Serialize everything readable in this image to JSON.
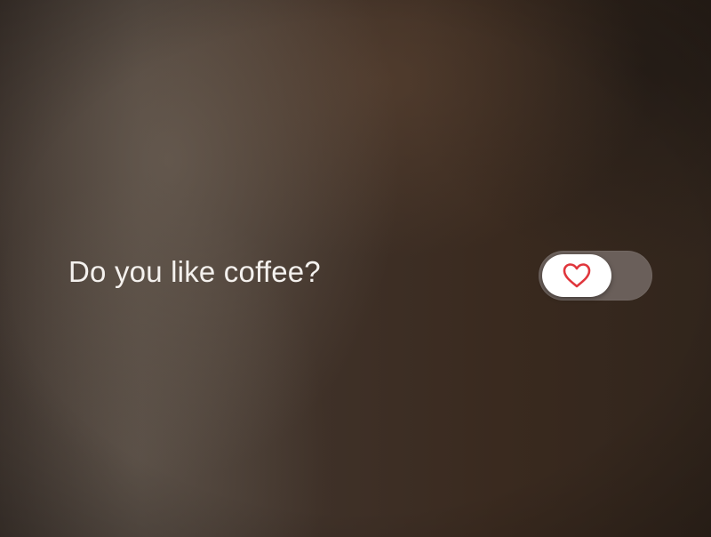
{
  "question": {
    "text": "Do you like coffee?"
  },
  "toggle": {
    "state": "off",
    "icon": "heart-icon",
    "icon_color": "#e0363c",
    "track_color": "#6a5f5a",
    "knob_color": "#ffffff"
  }
}
